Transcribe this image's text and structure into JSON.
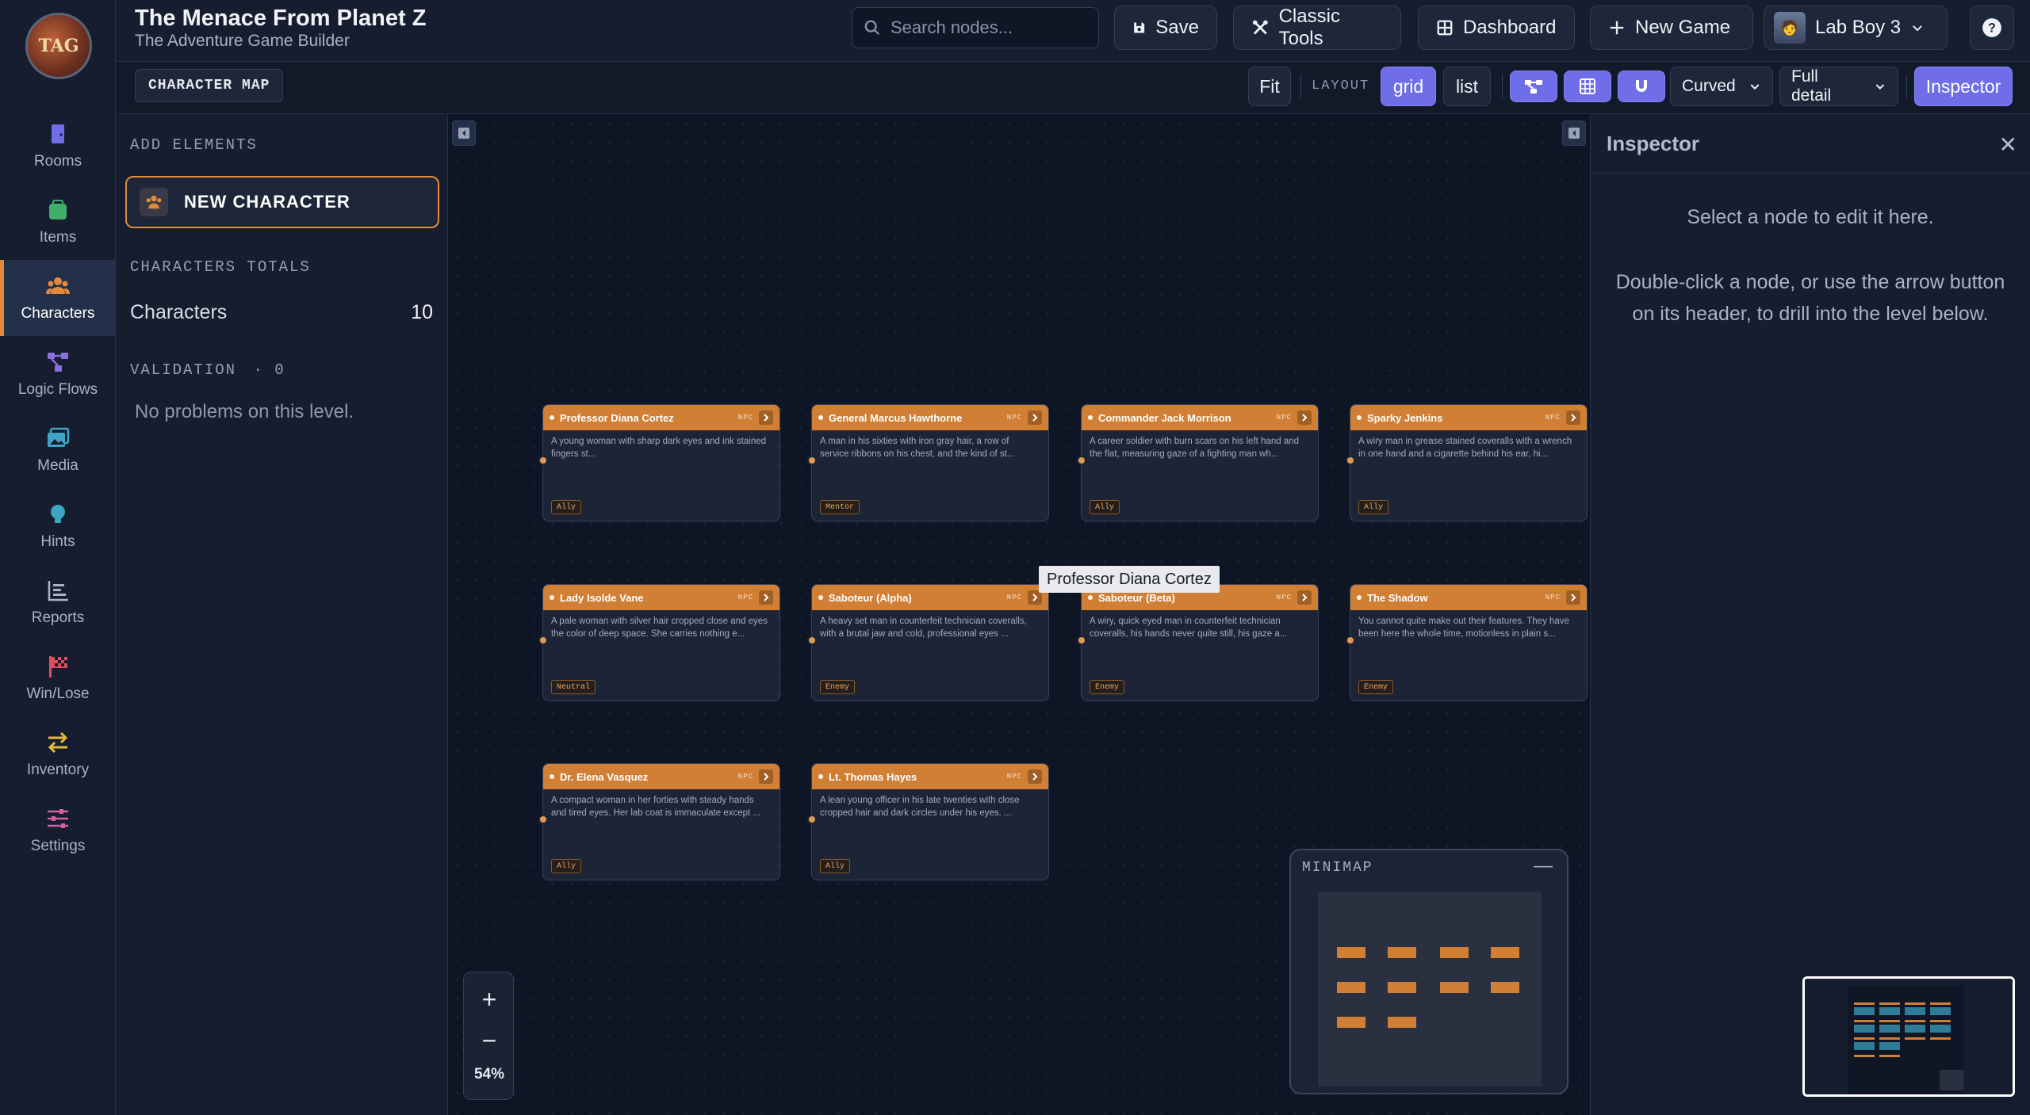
{
  "app": {
    "title": "The Menace From Planet Z",
    "subtitle": "The Adventure Game Builder",
    "logo_text": "TAG"
  },
  "search": {
    "placeholder": "Search nodes..."
  },
  "topbar": {
    "save_label": "Save",
    "classic_label": "Classic Tools",
    "dashboard_label": "Dashboard",
    "newgame_label": "New Game",
    "user_label": "Lab Boy 3"
  },
  "nav": [
    {
      "label": "Rooms",
      "icon": "door-icon",
      "color": "#6f6ee8"
    },
    {
      "label": "Items",
      "icon": "bag-icon",
      "color": "#3fae6b"
    },
    {
      "label": "Characters",
      "icon": "people-icon",
      "color": "#e28a3c"
    },
    {
      "label": "Logic Flows",
      "icon": "flow-icon",
      "color": "#8b6fe0"
    },
    {
      "label": "Media",
      "icon": "image-icon",
      "color": "#3ea6c4"
    },
    {
      "label": "Hints",
      "icon": "bulb-icon",
      "color": "#3ea6c4"
    },
    {
      "label": "Reports",
      "icon": "report-icon",
      "color": "#aab3c5"
    },
    {
      "label": "Win/Lose",
      "icon": "flag-icon",
      "color": "#e04e5e"
    },
    {
      "label": "Inventory",
      "icon": "swap-icon",
      "color": "#e8b83a"
    },
    {
      "label": "Settings",
      "icon": "sliders-icon",
      "color": "#d65ea5"
    }
  ],
  "subbar": {
    "map_label": "CHARACTER MAP",
    "fit_label": "Fit",
    "layout_label": "LAYOUT",
    "grid_label": "grid",
    "list_label": "list",
    "edge_style": "Curved",
    "detail_level": "Full detail",
    "inspector_label": "Inspector"
  },
  "panel": {
    "add_heading": "ADD ELEMENTS",
    "new_character_label": "NEW CHARACTER",
    "totals_heading": "CHARACTERS TOTALS",
    "characters_label": "Characters",
    "characters_count": "10",
    "validation_heading": "VALIDATION",
    "validation_count": "· 0",
    "no_problems": "No problems on this level."
  },
  "nodes": [
    {
      "title": "Professor Diana Cortez",
      "kind": "NPC",
      "desc": "A young woman with sharp dark eyes and ink stained fingers st...",
      "badge": "Ally"
    },
    {
      "title": "General Marcus Hawthorne",
      "kind": "NPC",
      "desc": "A man in his sixties with iron gray hair, a row of service ribbons on his chest, and the kind of st...",
      "badge": "Mentor"
    },
    {
      "title": "Commander Jack Morrison",
      "kind": "NPC",
      "desc": "A career soldier with burn scars on his left hand and the flat, measuring gaze of a fighting man wh...",
      "badge": "Ally"
    },
    {
      "title": "Sparky Jenkins",
      "kind": "NPC",
      "desc": "A wiry man in grease stained coveralls with a wrench in one hand and a cigarette behind his ear, hi...",
      "badge": "Ally"
    },
    {
      "title": "Lady Isolde Vane",
      "kind": "NPC",
      "desc": "A pale woman with silver hair cropped close and eyes the color of deep space. She carries nothing e...",
      "badge": "Neutral"
    },
    {
      "title": "Saboteur (Alpha)",
      "kind": "NPC",
      "desc": "A heavy set man in counterfeit technician coveralls, with a brutal jaw and cold, professional eyes ...",
      "badge": "Enemy"
    },
    {
      "title": "Saboteur (Beta)",
      "kind": "NPC",
      "desc": "A wiry, quick eyed man in counterfeit technician coveralls, his hands never quite still, his gaze a...",
      "badge": "Enemy"
    },
    {
      "title": "The Shadow",
      "kind": "NPC",
      "desc": "You cannot quite make out their features. They have been here the whole time, motionless in plain s...",
      "badge": "Enemy"
    },
    {
      "title": "Dr. Elena Vasquez",
      "kind": "NPC",
      "desc": "A compact woman in her forties with steady hands and tired eyes. Her lab coat is immaculate except ...",
      "badge": "Ally"
    },
    {
      "title": "Lt. Thomas Hayes",
      "kind": "NPC",
      "desc": "A lean young officer in his late twenties with close cropped hair and dark circles under his eyes. ...",
      "badge": "Ally"
    }
  ],
  "tooltip": "Professor Diana Cortez",
  "zoom": {
    "plus": "+",
    "minus": "−",
    "percent": "54%"
  },
  "minimap": {
    "title": "MINIMAP",
    "minimize": "—"
  },
  "inspector": {
    "title": "Inspector",
    "close": "✕",
    "msg1": "Select a node to edit it here.",
    "msg2": "Double-click a node, or use the arrow button on its header, to drill into the level below."
  },
  "colors": {
    "accent": "#6f6ee8",
    "node_header": "#d07f35",
    "highlight": "#e28a3c"
  }
}
